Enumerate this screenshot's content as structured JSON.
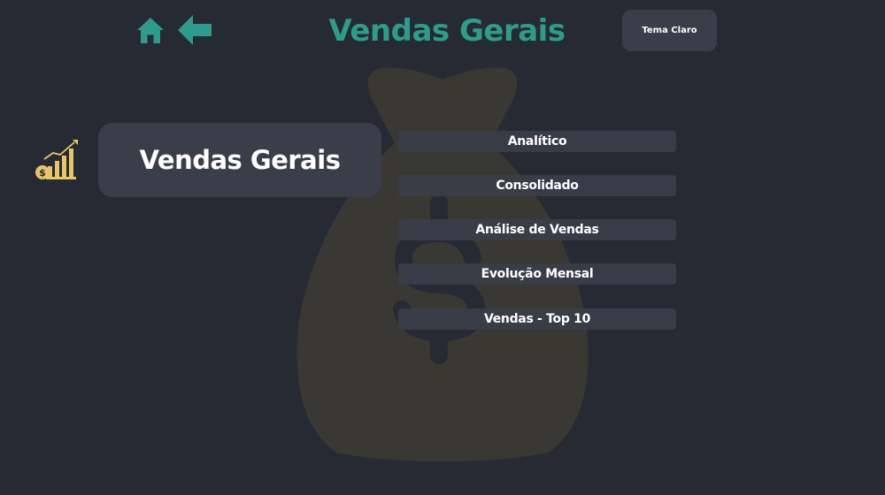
{
  "header": {
    "title": "Vendas Gerais",
    "theme_button_label": "Tema Claro"
  },
  "section": {
    "title": "Vendas Gerais"
  },
  "menu": {
    "items": [
      {
        "label": "Analítico"
      },
      {
        "label": "Consolidado"
      },
      {
        "label": "Análise de Vendas"
      },
      {
        "label": "Evolução Mensal"
      },
      {
        "label": "Vendas - Top 10"
      }
    ]
  },
  "colors": {
    "background": "#262a33",
    "accent": "#2e9b8c",
    "card": "#3a3e48",
    "icon_gold": "#e8c46a",
    "watermark": "#3a3832"
  },
  "icons": [
    "home-icon",
    "back-arrow-icon",
    "money-bag-icon",
    "sales-chart-icon"
  ]
}
